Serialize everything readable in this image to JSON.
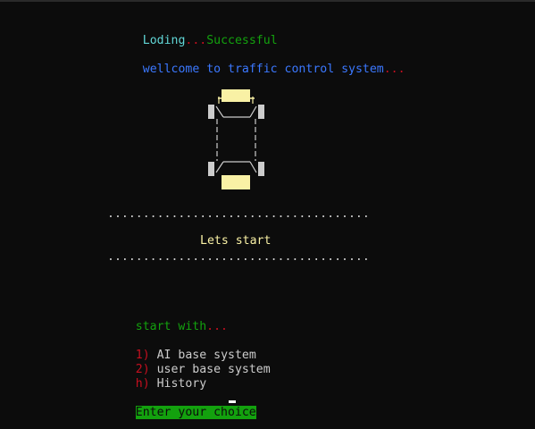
{
  "header": {
    "loading_prefix": "Loding",
    "loading_dots": "...",
    "loading_status": "Successful",
    "welcome_text": "wellcome to traffic control system",
    "welcome_dots": "..."
  },
  "divider": {
    "top": ".....................................",
    "bottom": "....................................."
  },
  "banner": {
    "text": "Lets start"
  },
  "menu": {
    "heading": "start with",
    "heading_dots": "...",
    "items": [
      {
        "key": "1)",
        "label": "AI base system"
      },
      {
        "key": "2)",
        "label": "user base system"
      },
      {
        "key": "h)",
        "label": "History"
      }
    ]
  },
  "prompt": {
    "text": "Enter your choice"
  },
  "colors": {
    "background": "#0c0c0c",
    "cyan": "#61d6d6",
    "green": "#13a10e",
    "red": "#c50f1f",
    "blue": "#3b78ff",
    "yellow": "#f9f1a5",
    "text": "#cccccc"
  },
  "icons": {
    "car": "car-top-view-icon",
    "cursor": "text-cursor-icon"
  }
}
